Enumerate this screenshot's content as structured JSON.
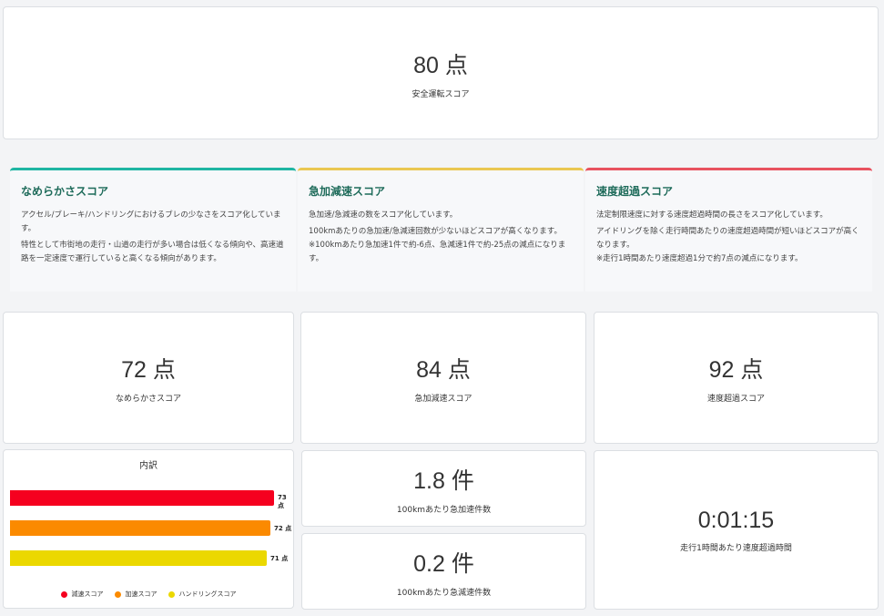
{
  "total": {
    "value": "80 点",
    "label": "安全運転スコア"
  },
  "descriptions": [
    {
      "title": "なめらかさスコア",
      "color": "#1fb5a3",
      "lines": [
        "アクセル/ブレーキ/ハンドリングにおけるブレの少なさをスコア化しています。",
        "特性として市街地の走行・山道の走行が多い場合は低くなる傾向や、高速道路を一定速度で運行していると高くなる傾向があります。"
      ]
    },
    {
      "title": "急加減速スコア",
      "color": "#eac752",
      "lines": [
        "急加速/急減速の数をスコア化しています。",
        "100kmあたりの急加速/急減速回数が少ないほどスコアが高くなります。",
        "※100kmあたり急加速1件で約-6点、急減速1件で約-25点の減点になります。"
      ]
    },
    {
      "title": "速度超過スコア",
      "color": "#e8525f",
      "lines": [
        "法定制限速度に対する速度超過時間の長さをスコア化しています。",
        "アイドリングを除く走行時間あたりの速度超過時間が短いほどスコアが高くなります。",
        "※走行1時間あたり速度超過1分で約7点の減点になります。"
      ]
    }
  ],
  "scores": [
    {
      "value": "72 点",
      "label": "なめらかさスコア"
    },
    {
      "value": "84 点",
      "label": "急加減速スコア"
    },
    {
      "value": "92 点",
      "label": "速度超過スコア"
    }
  ],
  "metrics": [
    {
      "value": "1.8 件",
      "label": "100kmあたり急加速件数"
    },
    {
      "value": "0.2 件",
      "label": "100kmあたり急減速件数"
    },
    {
      "value": "0:01:15",
      "label": "走行1時間あたり速度超過時間"
    }
  ],
  "chart_data": {
    "type": "bar",
    "orientation": "horizontal",
    "title": "内訳",
    "categories": [
      "減速スコア",
      "加速スコア",
      "ハンドリングスコア"
    ],
    "values": [
      73,
      72,
      71
    ],
    "data_labels": [
      "73 点",
      "72 点",
      "71 点"
    ],
    "colors": [
      "#f5001f",
      "#fb8a00",
      "#ebd800"
    ],
    "xlim": [
      0,
      73
    ],
    "legend": "bottom"
  }
}
